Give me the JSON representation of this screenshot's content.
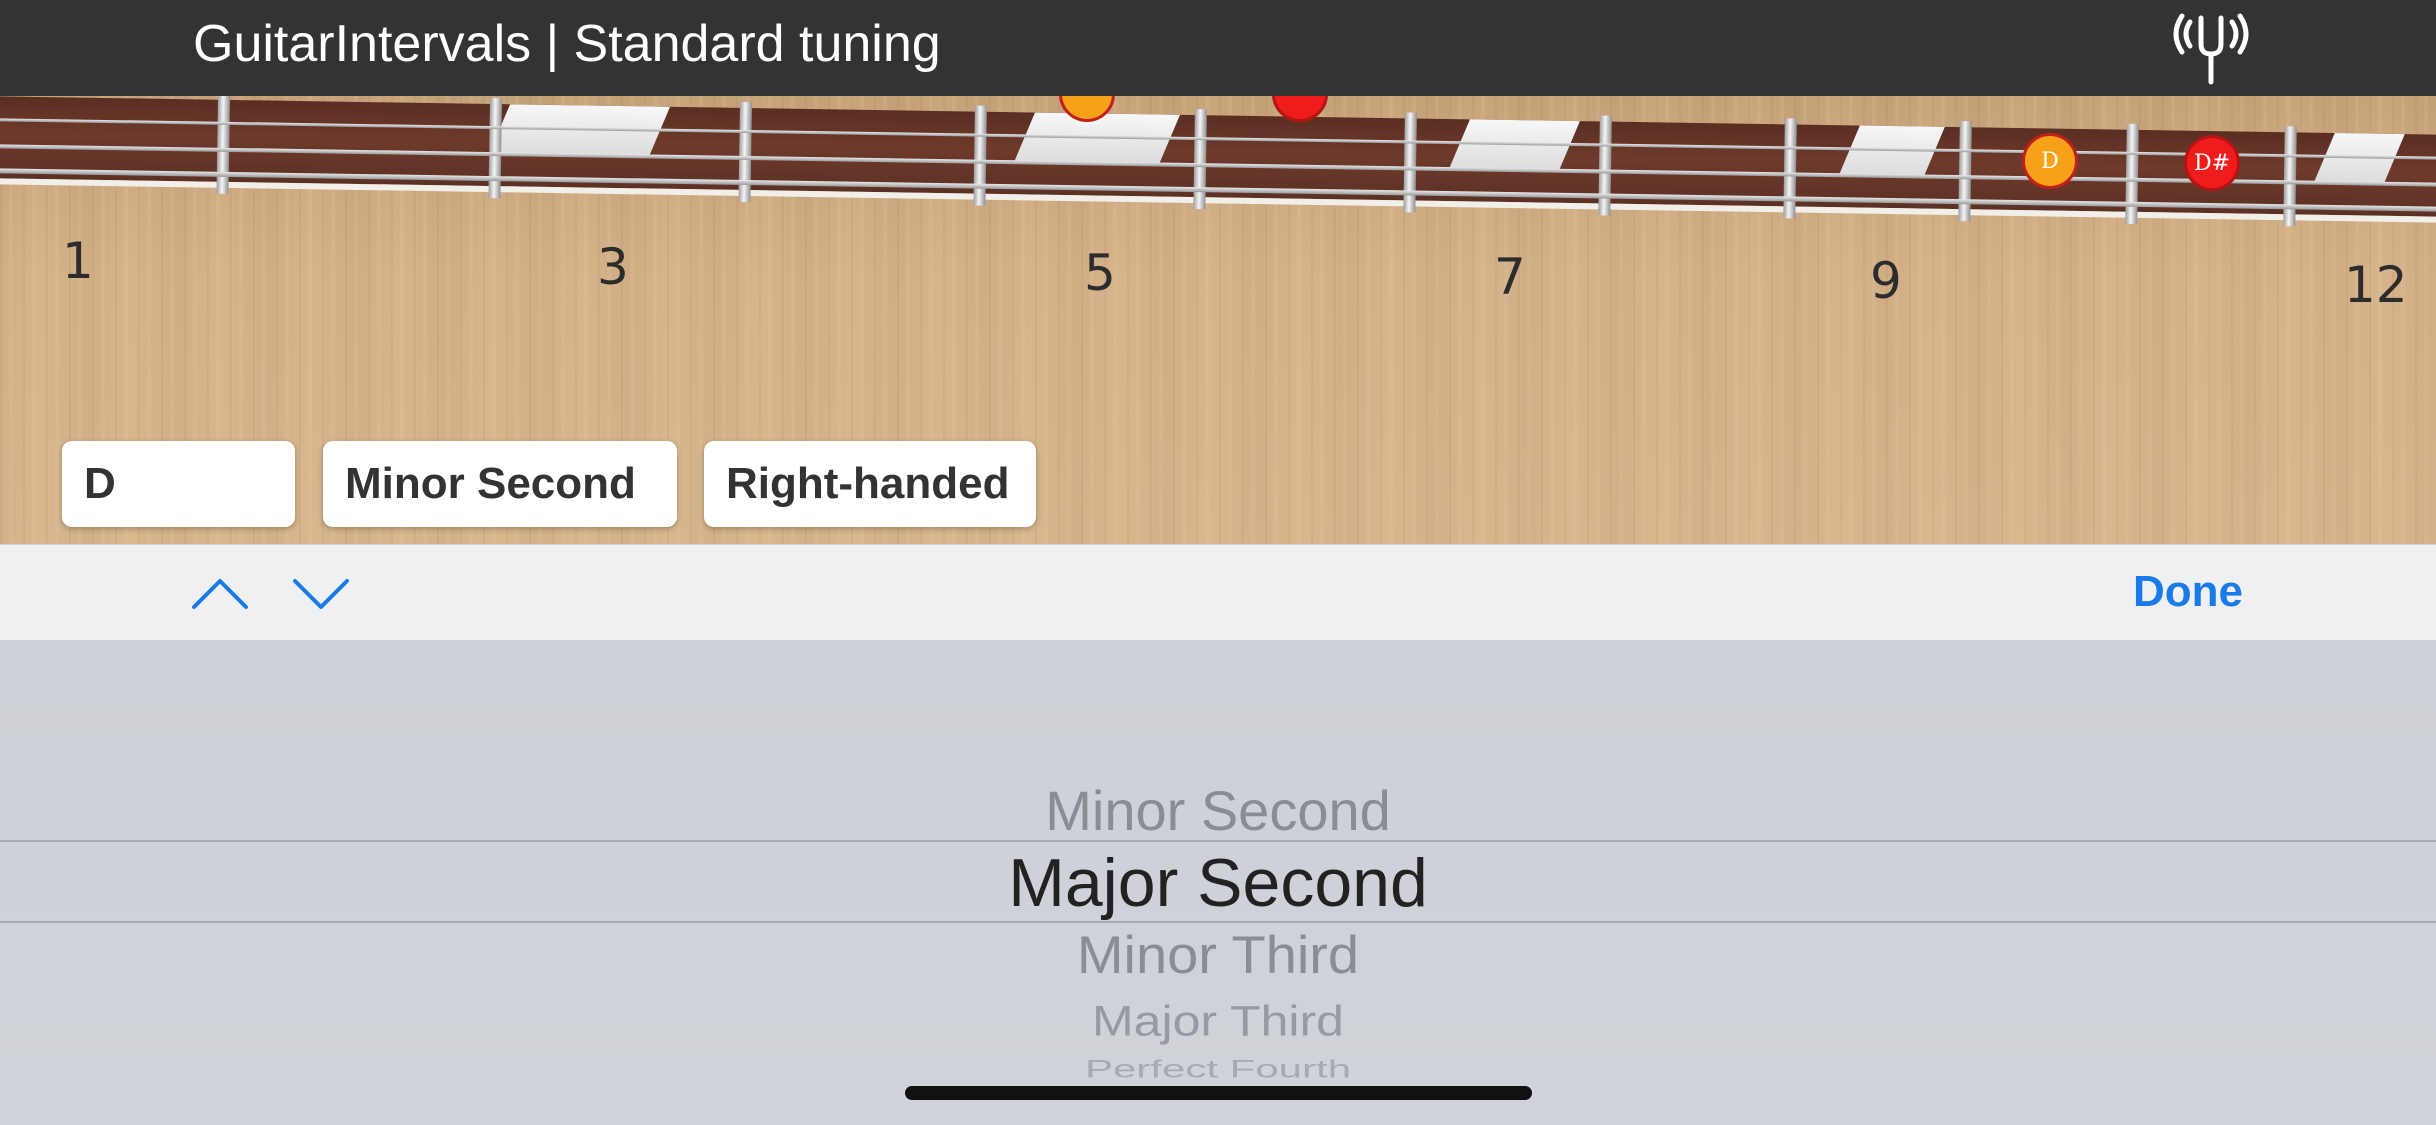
{
  "header": {
    "title": "GuitarIntervals | Standard tuning",
    "tuner_icon": "tuning-fork-icon"
  },
  "fretboard": {
    "fret_numbers": [
      "1",
      "3",
      "5",
      "7",
      "9",
      "12"
    ],
    "notes": [
      {
        "label": "D",
        "color": "#f6a119"
      },
      {
        "label": "D#",
        "color": "#f01c1c"
      }
    ]
  },
  "selectors": {
    "root_note": "D",
    "interval": "Minor Second",
    "handedness": "Right-handed"
  },
  "toolbar": {
    "prev_icon": "chevron-up-icon",
    "next_icon": "chevron-down-icon",
    "done_label": "Done",
    "accent_color": "#1a7ae6"
  },
  "picker": {
    "items": [
      "Minor Second",
      "Major Second",
      "Minor Third",
      "Major Third",
      "Perfect Fourth"
    ],
    "selected": "Major Second"
  }
}
